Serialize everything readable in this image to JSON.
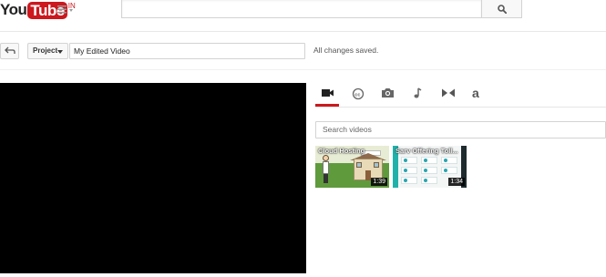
{
  "masthead": {
    "logo_you": "You",
    "logo_tube": "Tube",
    "logo_region": "IN",
    "guide_icon": "hamburger-menu-icon",
    "search_value": "",
    "search_icon": "search-icon"
  },
  "toolbar": {
    "back_icon": "undo-arrow-icon",
    "project_label": "Project",
    "title_value": "My Edited Video",
    "status": "All changes saved."
  },
  "panel": {
    "tabs": [
      {
        "icon": "video-camera-icon",
        "active": true
      },
      {
        "icon": "closed-captions-icon",
        "active": false
      },
      {
        "icon": "photo-camera-icon",
        "active": false
      },
      {
        "icon": "music-note-icon",
        "active": false
      },
      {
        "icon": "transitions-icon",
        "active": false
      },
      {
        "icon": "text-a-icon",
        "label": "a",
        "active": false
      }
    ],
    "search_placeholder": "Search videos",
    "videos": [
      {
        "title": "Cloud Hosting",
        "duration": "1:39"
      },
      {
        "title": "Sarv Offering Toll...",
        "duration": "1:34"
      }
    ]
  },
  "colors": {
    "brand_red": "#cc181e",
    "player_bg": "#000000"
  }
}
